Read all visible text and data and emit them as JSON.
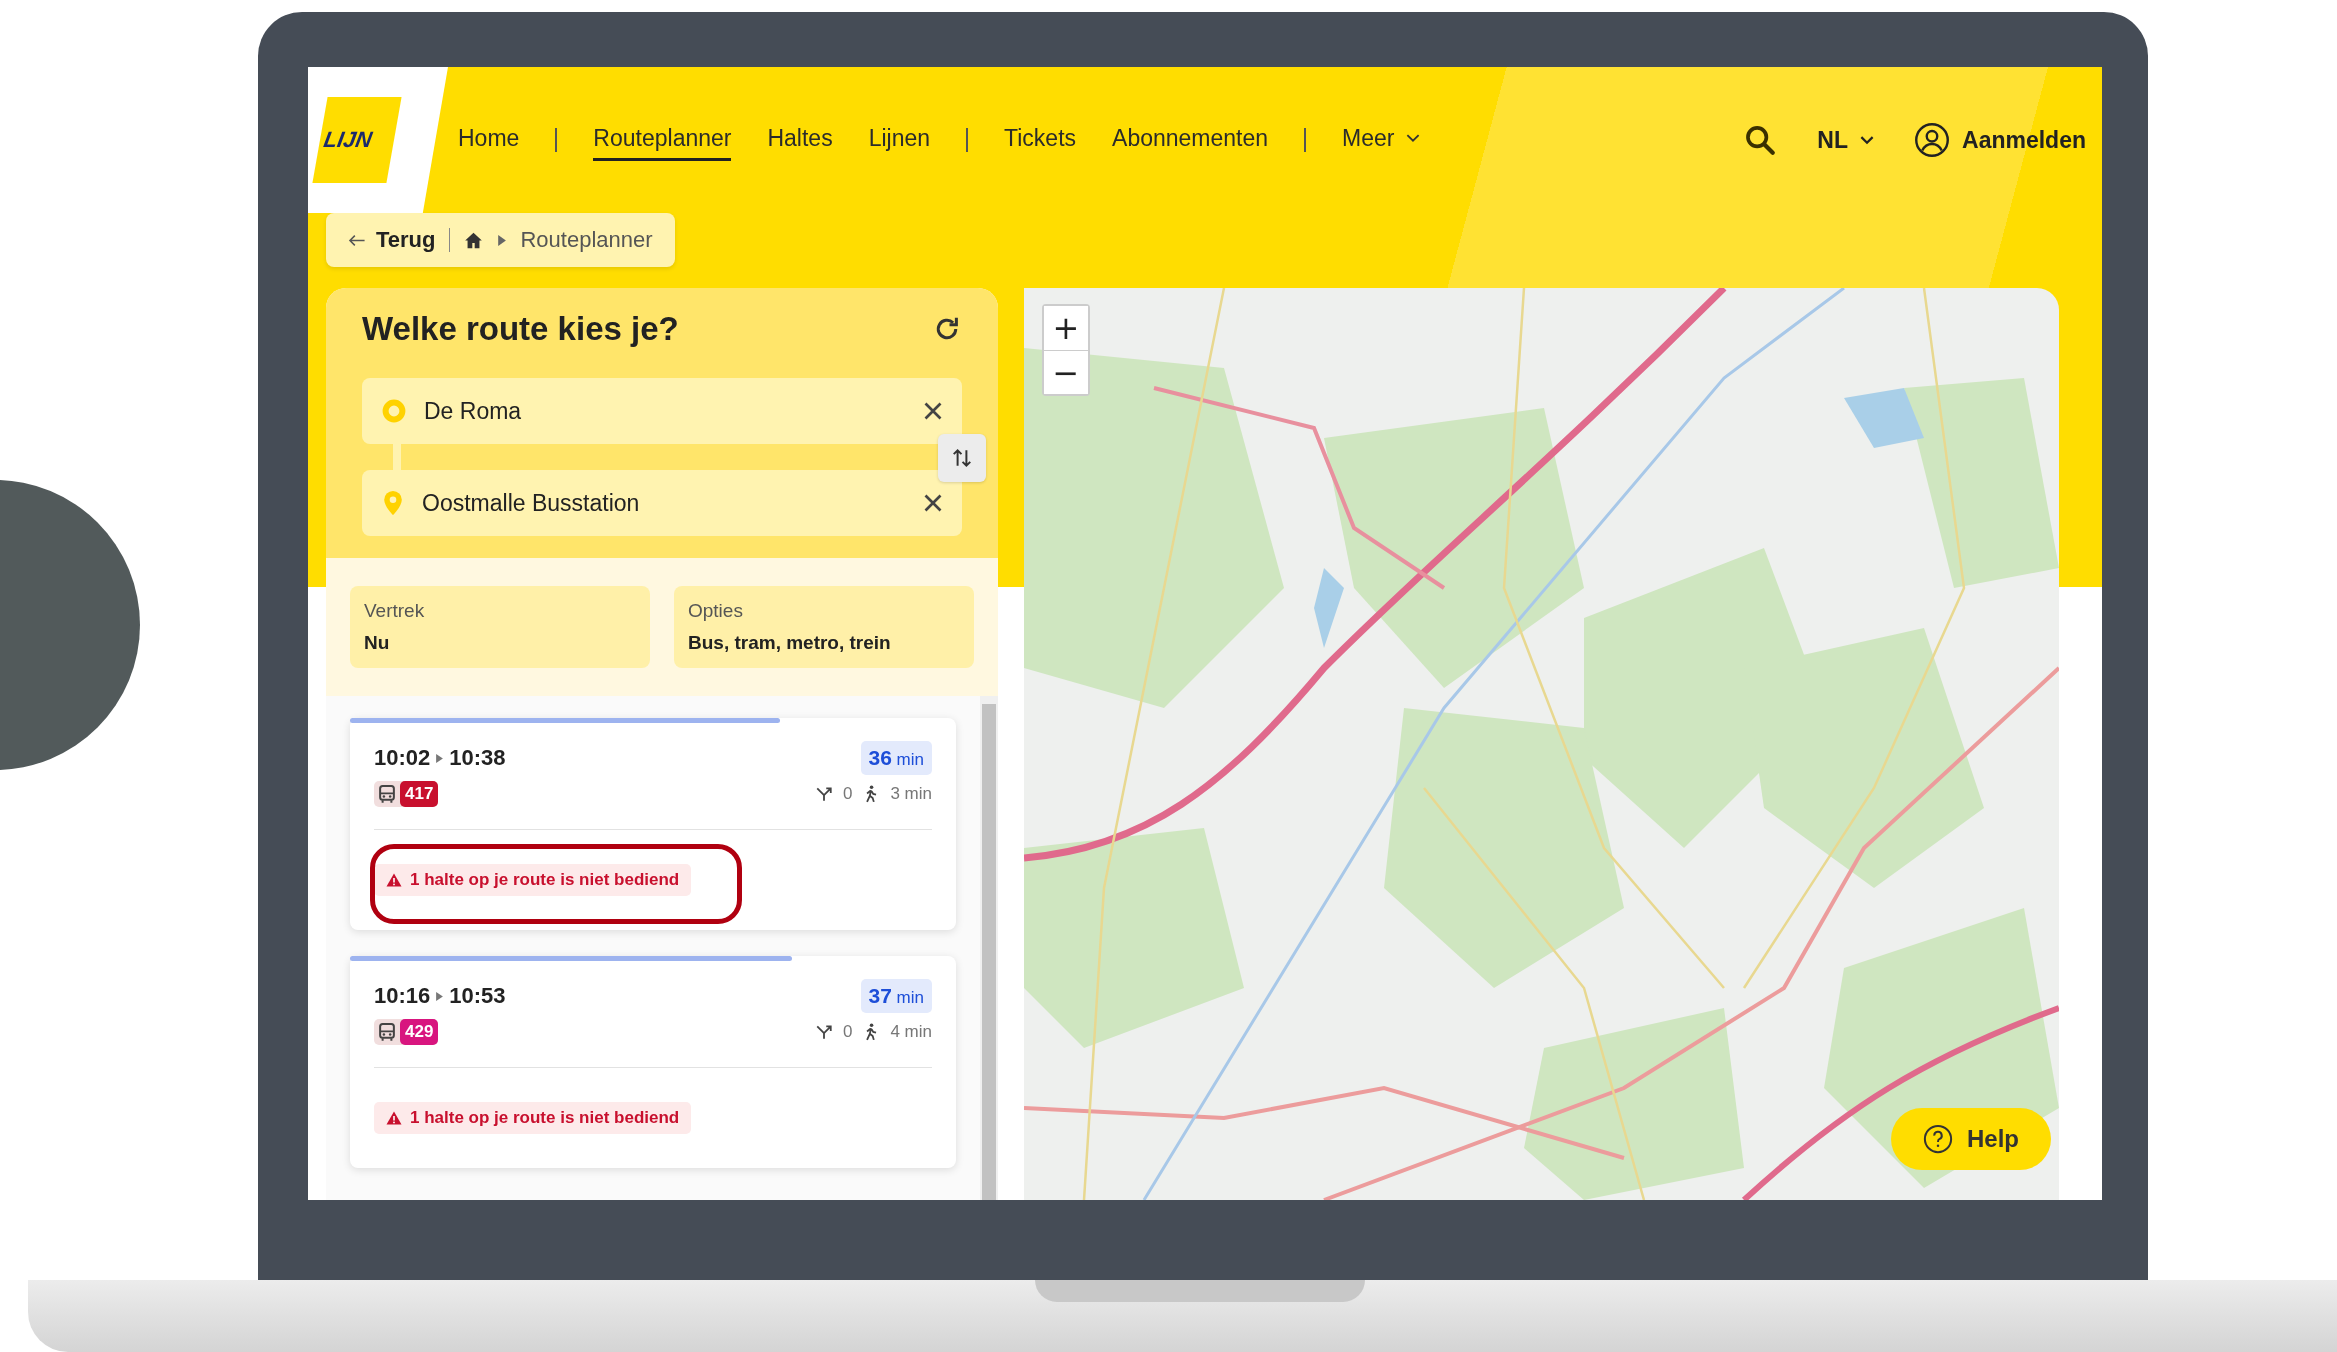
{
  "logo": {
    "text": "LIJN"
  },
  "nav": {
    "groups": [
      [
        {
          "label": "Home",
          "selected": false,
          "kind": "link"
        }
      ],
      [
        {
          "label": "Routeplanner",
          "selected": true,
          "kind": "link"
        },
        {
          "label": "Haltes",
          "selected": false,
          "kind": "link"
        },
        {
          "label": "Lijnen",
          "selected": false,
          "kind": "link"
        }
      ],
      [
        {
          "label": "Tickets",
          "selected": false,
          "kind": "link"
        },
        {
          "label": "Abonnementen",
          "selected": false,
          "kind": "link"
        }
      ],
      [
        {
          "label": "Meer",
          "selected": false,
          "kind": "dropdown"
        }
      ]
    ]
  },
  "language": {
    "label": "NL"
  },
  "account": {
    "label": "Aanmelden"
  },
  "breadcrumb": {
    "back": "Terug",
    "current": "Routeplanner"
  },
  "planner": {
    "title": "Welke route kies je?",
    "from": {
      "value": "De Roma"
    },
    "to": {
      "value": "Oostmalle Busstation"
    },
    "options": [
      {
        "label": "Vertrek",
        "value": "Nu"
      },
      {
        "label": "Opties",
        "value": "Bus, tram, metro, trein"
      }
    ]
  },
  "results": [
    {
      "depart": "10:02",
      "arrive": "10:38",
      "duration": "36",
      "unit": "min",
      "line": "417",
      "color": "#c8102e",
      "transfers": "0",
      "walk": "3 min",
      "warning": "1 halte op je route is niet bediend",
      "annotated": true,
      "level": 0.71
    },
    {
      "depart": "10:16",
      "arrive": "10:53",
      "duration": "37",
      "unit": "min",
      "line": "429",
      "color": "#d8157f",
      "transfers": "0",
      "walk": "4 min",
      "warning": "1 halte op je route is niet bediend",
      "annotated": false,
      "level": 0.73
    }
  ],
  "map": {
    "zoom_in": "+",
    "zoom_out": "−",
    "help": "Help"
  }
}
